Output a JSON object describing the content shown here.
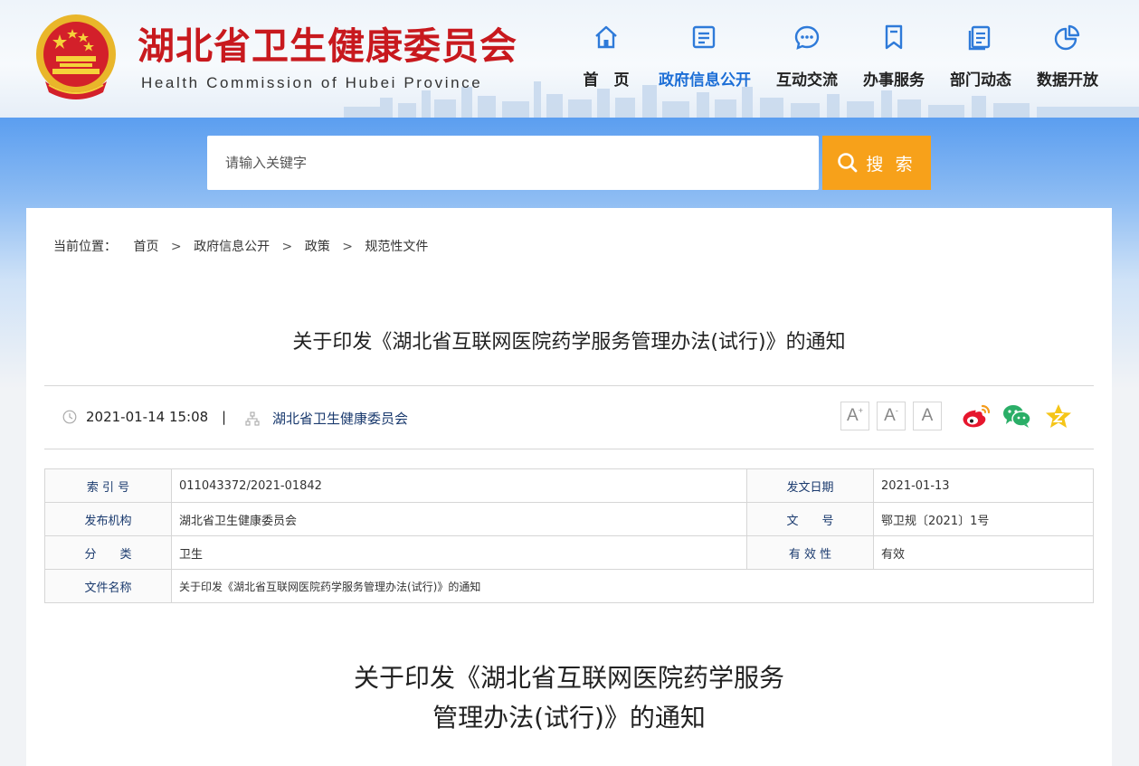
{
  "header": {
    "title": "湖北省卫生健康委员会",
    "subtitle": "Health Commission of Hubei Province",
    "brand_color": "#c8191e"
  },
  "nav": {
    "items": [
      {
        "label": "首　页",
        "icon": "home-icon",
        "active": false
      },
      {
        "label": "政府信息公开",
        "icon": "document-icon",
        "active": true
      },
      {
        "label": "互动交流",
        "icon": "chat-icon",
        "active": false
      },
      {
        "label": "办事服务",
        "icon": "bookmark-icon",
        "active": false
      },
      {
        "label": "部门动态",
        "icon": "news-icon",
        "active": false
      },
      {
        "label": "数据开放",
        "icon": "pie-chart-icon",
        "active": false
      }
    ],
    "active_color": "#1c6ed6"
  },
  "search": {
    "placeholder": "请输入关键字",
    "button_label": "搜 索",
    "button_color": "#f7a11a"
  },
  "breadcrumb": {
    "prefix": "当前位置：",
    "items": [
      "首页",
      "政府信息公开",
      "政策",
      "规范性文件"
    ]
  },
  "document": {
    "title": "关于印发《湖北省互联网医院药学服务管理办法(试行)》的通知",
    "datetime": "2021-01-14 15:08",
    "divider": "|",
    "source": "湖北省卫生健康委员会",
    "font_sizes": [
      "A+",
      "A-",
      "A"
    ],
    "share": [
      "weibo-icon",
      "wechat-icon",
      "favorite-icon"
    ]
  },
  "info_table": {
    "rows": [
      {
        "label1": "索 引 号",
        "value1": "011043372/2021-01842",
        "label2": "发文日期",
        "value2": "2021-01-13"
      },
      {
        "label1": "发布机构",
        "value1": "湖北省卫生健康委员会",
        "label2": "文　　号",
        "value2": "鄂卫规〔2021〕1号"
      },
      {
        "label1": "分　　类",
        "value1": "卫生",
        "label2": "有 效 性",
        "value2": "有效"
      }
    ],
    "file_name_label": "文件名称",
    "file_name_value": "关于印发《湖北省互联网医院药学服务管理办法(试行)》的通知"
  },
  "body": {
    "title_line1": "关于印发《湖北省互联网医院药学服务",
    "title_line2": "管理办法(试行)》的通知"
  }
}
